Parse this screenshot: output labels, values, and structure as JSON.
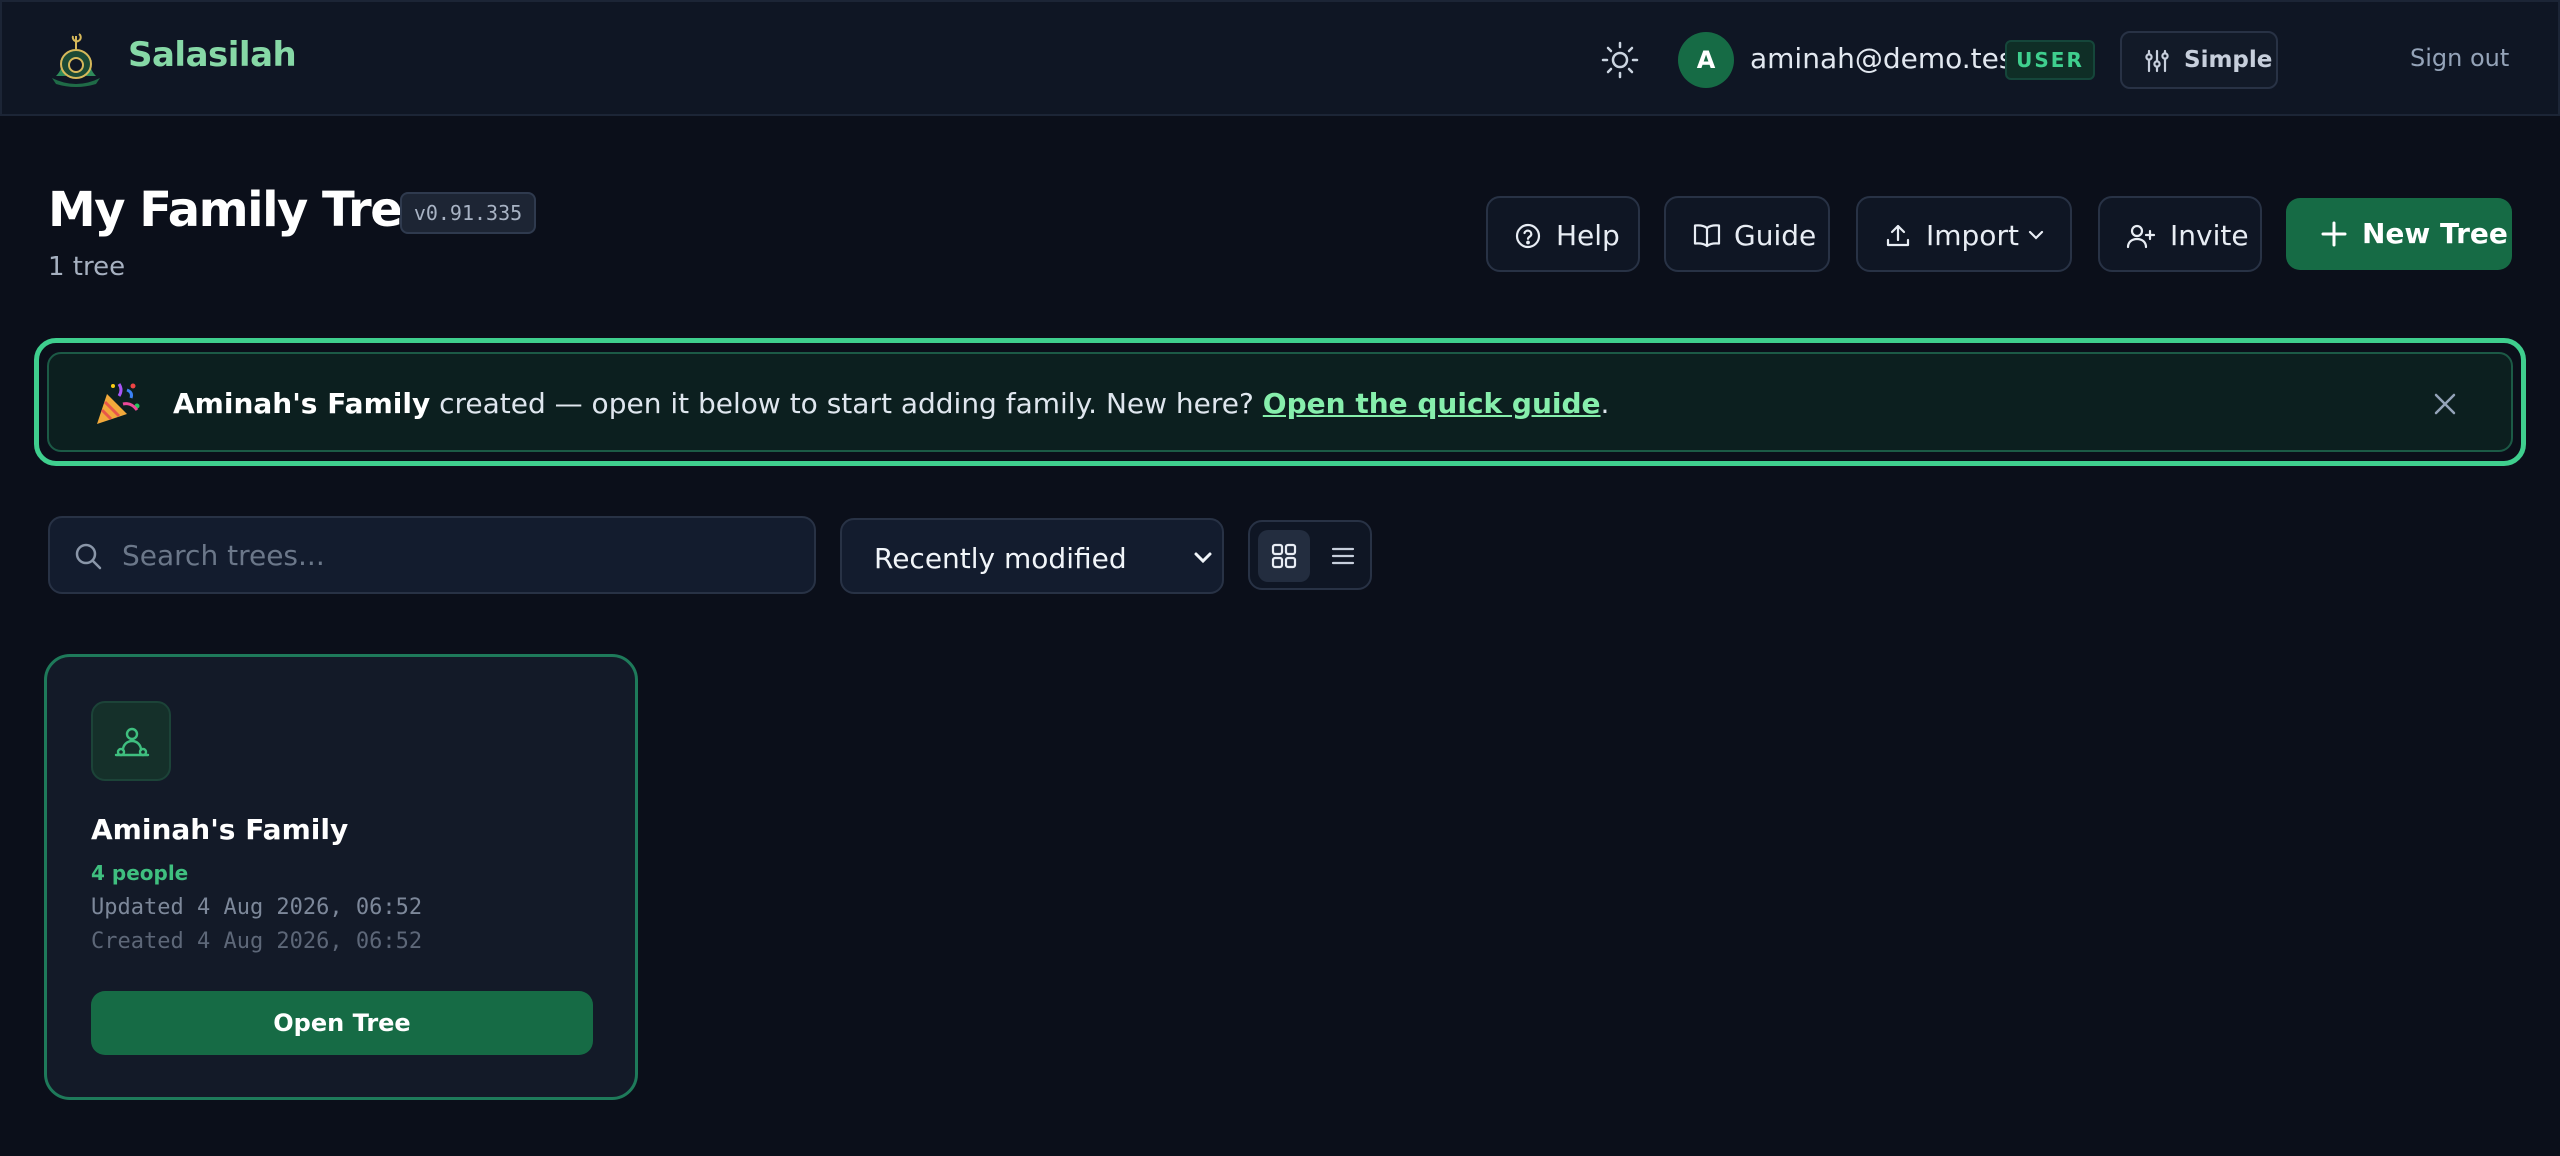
{
  "app": {
    "brand": "Salasilah"
  },
  "header": {
    "avatar_initial": "A",
    "email": "aminah@demo.test",
    "role_badge": "USER",
    "mode_label": "Simple",
    "sign_out_label": "Sign out"
  },
  "page": {
    "title": "My Family Trees",
    "version": "v0.91.335",
    "tree_count": "1 tree"
  },
  "actions": {
    "help_label": "Help",
    "guide_label": "Guide",
    "import_label": "Import",
    "invite_label": "Invite",
    "new_tree_label": "New Tree"
  },
  "banner": {
    "tree_name": "Aminah's Family",
    "message": " created — open it below to start adding family. New here? ",
    "link_label": "Open the quick guide",
    "trailing": "."
  },
  "toolbar": {
    "search_placeholder": "Search trees...",
    "search_value": "",
    "sort_value": "Recently modified",
    "view_mode": "grid"
  },
  "trees": [
    {
      "name": "Aminah's Family",
      "people": "4 people",
      "updated": "Updated 4 Aug 2026, 06:52",
      "created": "Created 4 Aug 2026, 06:52",
      "open_label": "Open Tree"
    }
  ],
  "colors": {
    "background": "#0b0f1a",
    "accent": "#166b45",
    "accent_bright": "#3fcf8e",
    "brand_text": "#86d8a6"
  },
  "icons": {
    "logo": "mosque-logo-icon",
    "theme": "sun-icon",
    "mode": "sliders-icon",
    "help": "help-circle-icon",
    "guide": "book-open-icon",
    "import": "upload-icon",
    "invite": "user-plus-icon",
    "new_tree": "plus-icon",
    "banner": "party-popper-icon",
    "close": "close-icon",
    "search": "search-icon",
    "grid": "grid-view-icon",
    "list": "list-view-icon",
    "tree": "people-icon"
  }
}
